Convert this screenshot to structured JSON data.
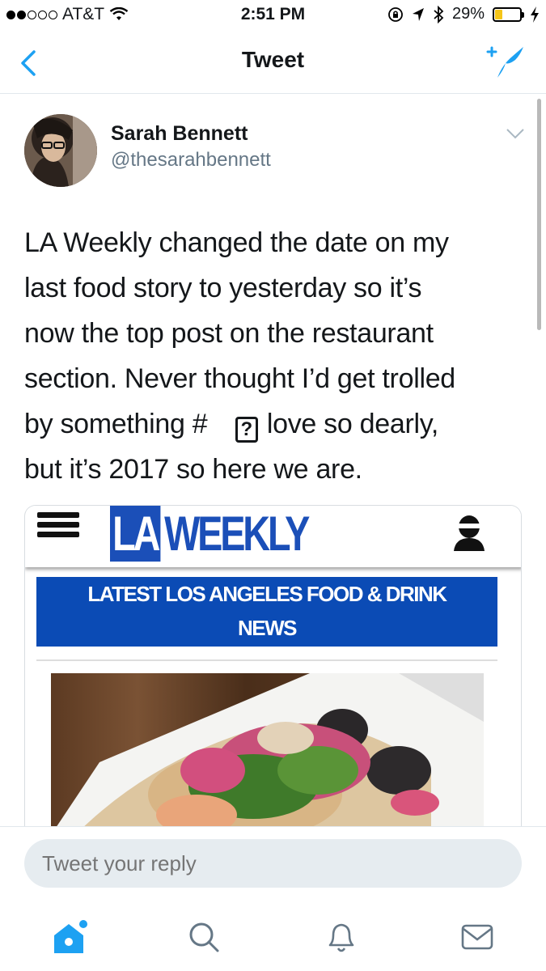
{
  "status_bar": {
    "carrier": "AT&T",
    "time": "2:51 PM",
    "battery": "29%",
    "battery_level": 0.29
  },
  "nav": {
    "title": "Tweet",
    "back_icon": "chevron-left-icon",
    "compose_icon": "compose-tweet-icon"
  },
  "tweet": {
    "author_name": "Sarah Bennett",
    "author_handle": "@thesarahbennett",
    "text_lines": [
      "LA Weekly changed the date on my",
      "last food story to yesterday so it’s",
      "now the top post on the restaurant",
      "section. Never thought I’d get trolled",
      "by something #",
      "love so dearly,",
      "but it’s 2017 so here we are."
    ],
    "missing_glyph": "?"
  },
  "media": {
    "logo_box": "LA",
    "logo_text": "WEEKLY",
    "banner_line1": "LATEST LOS ANGELES FOOD & DRINK",
    "banner_line2": "NEWS",
    "brand_blue": "#0b4bb5"
  },
  "reply": {
    "placeholder": "Tweet your reply"
  },
  "tab_bar": {
    "items": [
      "home-icon",
      "search-icon",
      "notifications-icon",
      "messages-icon"
    ],
    "active": "home-icon",
    "accent": "#1da1f2"
  }
}
